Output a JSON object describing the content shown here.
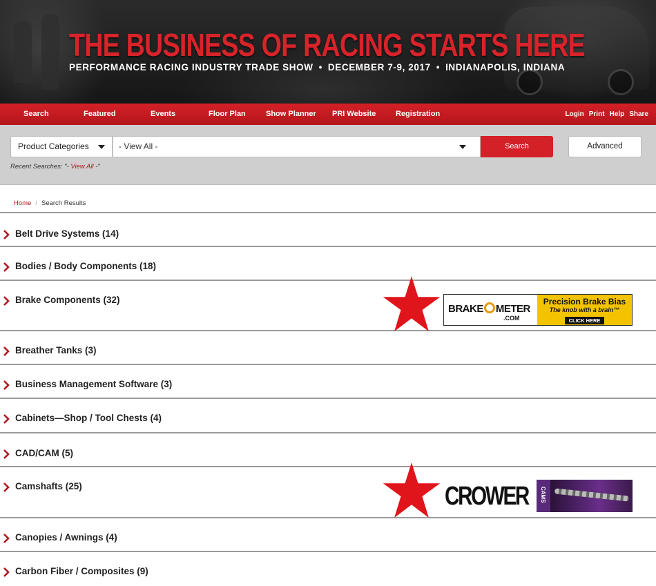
{
  "banner": {
    "title": "THE BUSINESS OF RACING STARTS HERE",
    "subtitle_parts": [
      "PERFORMANCE RACING INDUSTRY TRADE SHOW",
      "DECEMBER 7-9, 2017",
      "INDIANAPOLIS, INDIANA"
    ],
    "separator": "•"
  },
  "nav": {
    "items": [
      "Search",
      "Featured",
      "Events",
      "Floor Plan",
      "Show Planner",
      "PRI Website",
      "Registration"
    ],
    "right": [
      "Login",
      "Print",
      "Help",
      "Share"
    ]
  },
  "search": {
    "category_select": "Product Categories",
    "view_select": "- View All -",
    "search_button": "Search",
    "advanced_button": "Advanced",
    "recent_label": "Recent Searches: \"-",
    "recent_link": "View All",
    "recent_suffix": "-\""
  },
  "breadcrumb": {
    "home": "Home",
    "separator": "/",
    "current": "Search Results"
  },
  "categories": [
    "Belt Drive Systems (14)",
    "Bodies / Body Components (18)",
    "Brake Components (32)",
    "Breather Tanks (3)",
    "Business Management Software (3)",
    "Cabinets—Shop / Tool Chests (4)",
    "CAD/CAM (5)",
    "Camshafts (25)",
    "Canopies / Awnings (4)",
    "Carbon Fiber / Composites (9)"
  ],
  "ads": {
    "brake": {
      "brand_a": "BRAKE",
      "brand_b": "METER",
      "domain": ".COM",
      "headline": "Precision Brake Bias",
      "tagline": "The knob with a brain™",
      "cta": "CLICK HERE"
    },
    "crower": {
      "brand": "CROWER",
      "product": "CAMS"
    }
  },
  "colors": {
    "brand_red": "#d42027",
    "star_red": "#e0141b",
    "nav_red": "#b5161c",
    "search_bg": "#cfcfcf"
  }
}
